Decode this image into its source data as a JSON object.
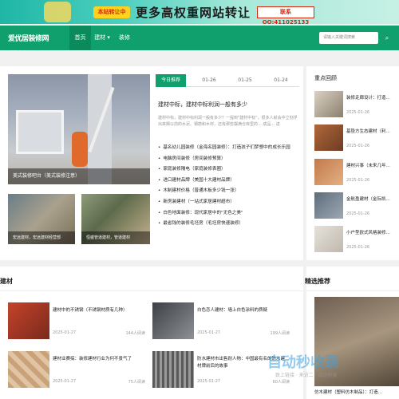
{
  "banner": {
    "badge": "本站转让中",
    "slogan": "更多高权重网站转让",
    "qq": "联系QQ:411025133"
  },
  "nav": {
    "logo": "爱优居装修网",
    "items": [
      {
        "label": "首页"
      },
      {
        "label": "建材 ▾"
      },
      {
        "label": "装修"
      }
    ],
    "search_placeholder": "请输入关键词搜索",
    "search_icon": "search-icon"
  },
  "hero": {
    "caption": "美式装修吧台（美式装修注意）"
  },
  "thumbs": [
    {
      "caption": "宏远建材，宏远建材经营部"
    },
    {
      "caption": "恒盛管道建材，管道建材"
    }
  ],
  "tabs": [
    "今日推荐",
    "01-26",
    "01-25",
    "01-24"
  ],
  "featured": {
    "title": "建材中标，建材中标利润一般有多少",
    "desc": "建材中标，建材中标利润一般有多少？一提到\"建材中标\"，很多人就会中立刻浮出来搁以前的水泥、钢筋和木材，还有那些摆满仓库里的... 成品... 进"
  },
  "list": [
    "基名幼儿园装修（金海名园装修）：打造孩子们梦想中的成长乐园",
    "电脑房间装修（房间装修预算）",
    "家庭装修隔电（家庭装修表圈）",
    "进口建材品牌（美国十大建材品牌）",
    "木制建材价格（普通木板多少钱一张）",
    "新房装建材（一站式家居建材超市）",
    "白色地面装修：现代家居中的\"无色之美\"",
    "最省钱的装修毛坯房（毛坯房快速装修）"
  ],
  "sidebar": {
    "title": "重点回顾",
    "items": [
      {
        "title": "装修走廊设计：打造...",
        "date": "2025-01-26"
      },
      {
        "title": "基垫方生态建材（利...",
        "date": "2025-01-26"
      },
      {
        "title": "建材兴事（未来几年...",
        "date": "2025-01-26"
      },
      {
        "title": "金航盈建材（金际凯...",
        "date": "2025-01-26"
      },
      {
        "title": "小户型欧式风格装修...",
        "date": "2025-01-26"
      }
    ]
  },
  "sections": {
    "jiancai": "建材",
    "jingxuan": "精选推荐"
  },
  "bottom": [
    {
      "title": "建材中的不锈钢（不锈钢材质有几种）",
      "date": "2025-01-27",
      "reads": "144人阅读"
    },
    {
      "title": "白色恋人建材：墙上白色涂料的质疑",
      "date": "2025-01-27",
      "reads": "199人阅读"
    },
    {
      "title": "建材业赛搞：装修建材行业为何不景气了",
      "date": "2025-01-27",
      "reads": "75人阅读"
    },
    {
      "title": "防水建材市出售耐人物：中国最有名的防水建材牌前后的故事",
      "date": "2025-01-27",
      "reads": "60人阅读"
    }
  ],
  "jingxuan_caption": "仿木建材（塑料仿木制品）：打造...",
  "watermark": {
    "main": "自动秒收录",
    "sub": "致上链接 · 来访二 · 自动收录"
  }
}
